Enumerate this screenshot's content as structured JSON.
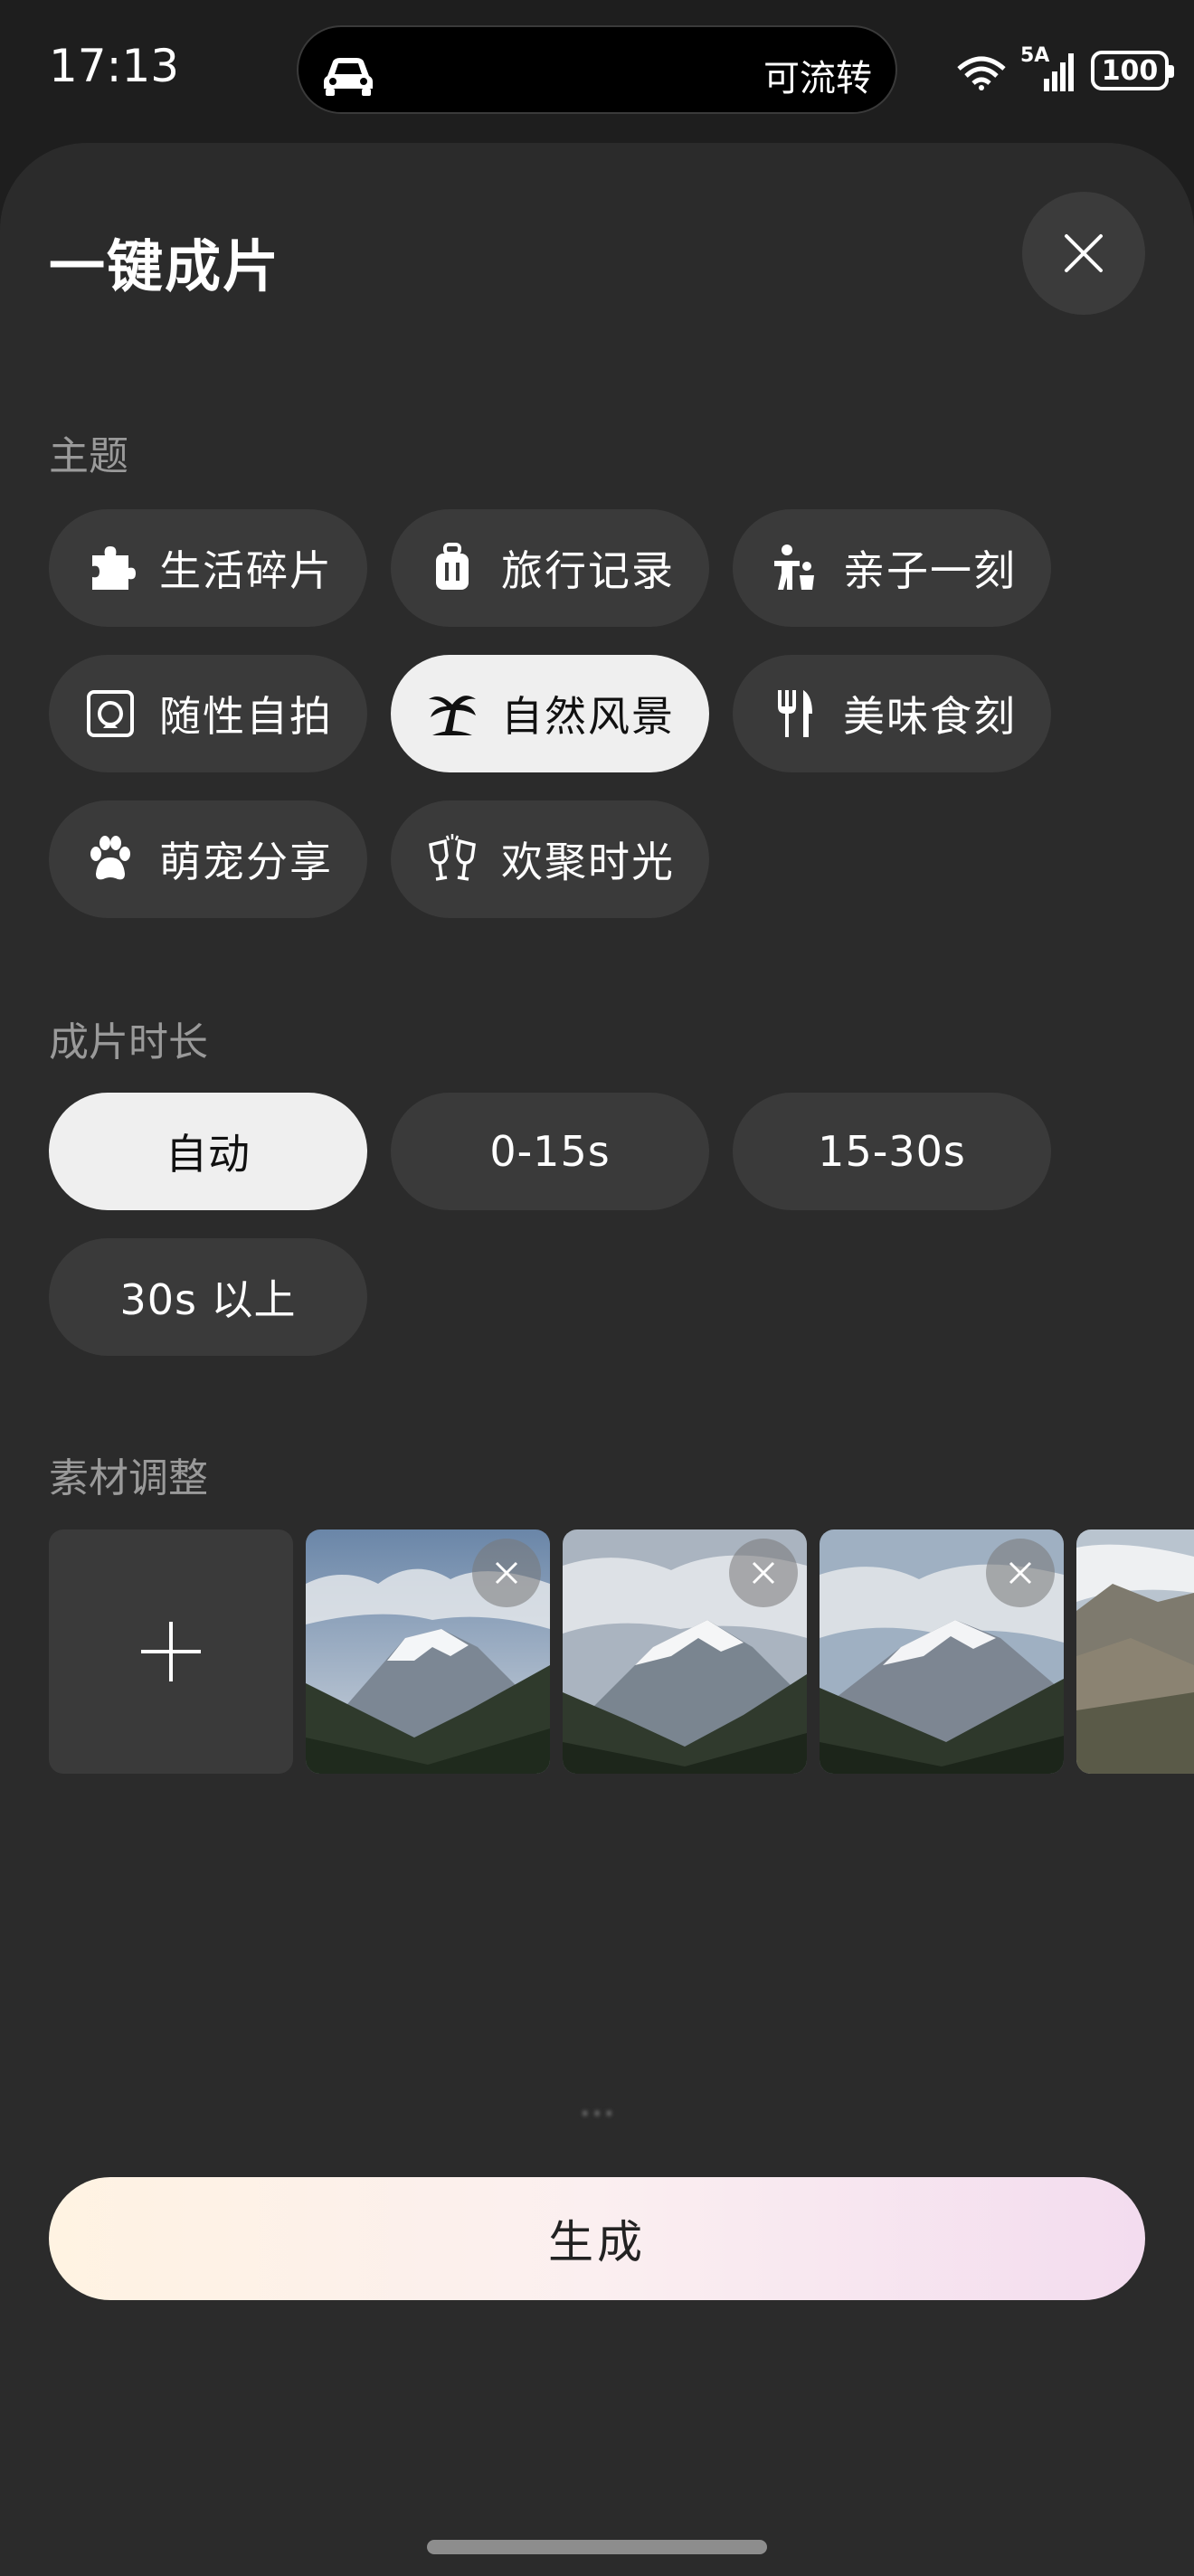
{
  "status_bar": {
    "time": "17:13",
    "island_text": "可流转",
    "network": "5A",
    "battery": "100"
  },
  "sheet": {
    "title": "一键成片"
  },
  "theme": {
    "label": "主题",
    "chips": [
      {
        "label": "生活碎片",
        "icon": "puzzle-icon",
        "selected": false
      },
      {
        "label": "旅行记录",
        "icon": "luggage-icon",
        "selected": false
      },
      {
        "label": "亲子一刻",
        "icon": "family-icon",
        "selected": false
      },
      {
        "label": "随性自拍",
        "icon": "selfie-icon",
        "selected": false
      },
      {
        "label": "自然风景",
        "icon": "palm-tree-icon",
        "selected": true
      },
      {
        "label": "美味食刻",
        "icon": "fork-knife-icon",
        "selected": false
      },
      {
        "label": "萌宠分享",
        "icon": "paw-icon",
        "selected": false
      },
      {
        "label": "欢聚时光",
        "icon": "cheers-icon",
        "selected": false
      }
    ]
  },
  "duration": {
    "label": "成片时长",
    "options": [
      {
        "label": "自动",
        "selected": true
      },
      {
        "label": "0-15s",
        "selected": false
      },
      {
        "label": "15-30s",
        "selected": false
      },
      {
        "label": "30s 以上",
        "selected": false
      }
    ]
  },
  "materials": {
    "label": "素材调整",
    "add_icon": "plus-icon",
    "thumbnail_count": 4
  },
  "loading_text": "...",
  "generate_button": {
    "label": "生成"
  },
  "colors": {
    "sheet_bg": "#2b2b2b",
    "chip_bg": "#3a3a3a",
    "chip_selected_bg": "#efefef",
    "gradient_start": "#fff3e2",
    "gradient_end": "#f3dcef"
  }
}
